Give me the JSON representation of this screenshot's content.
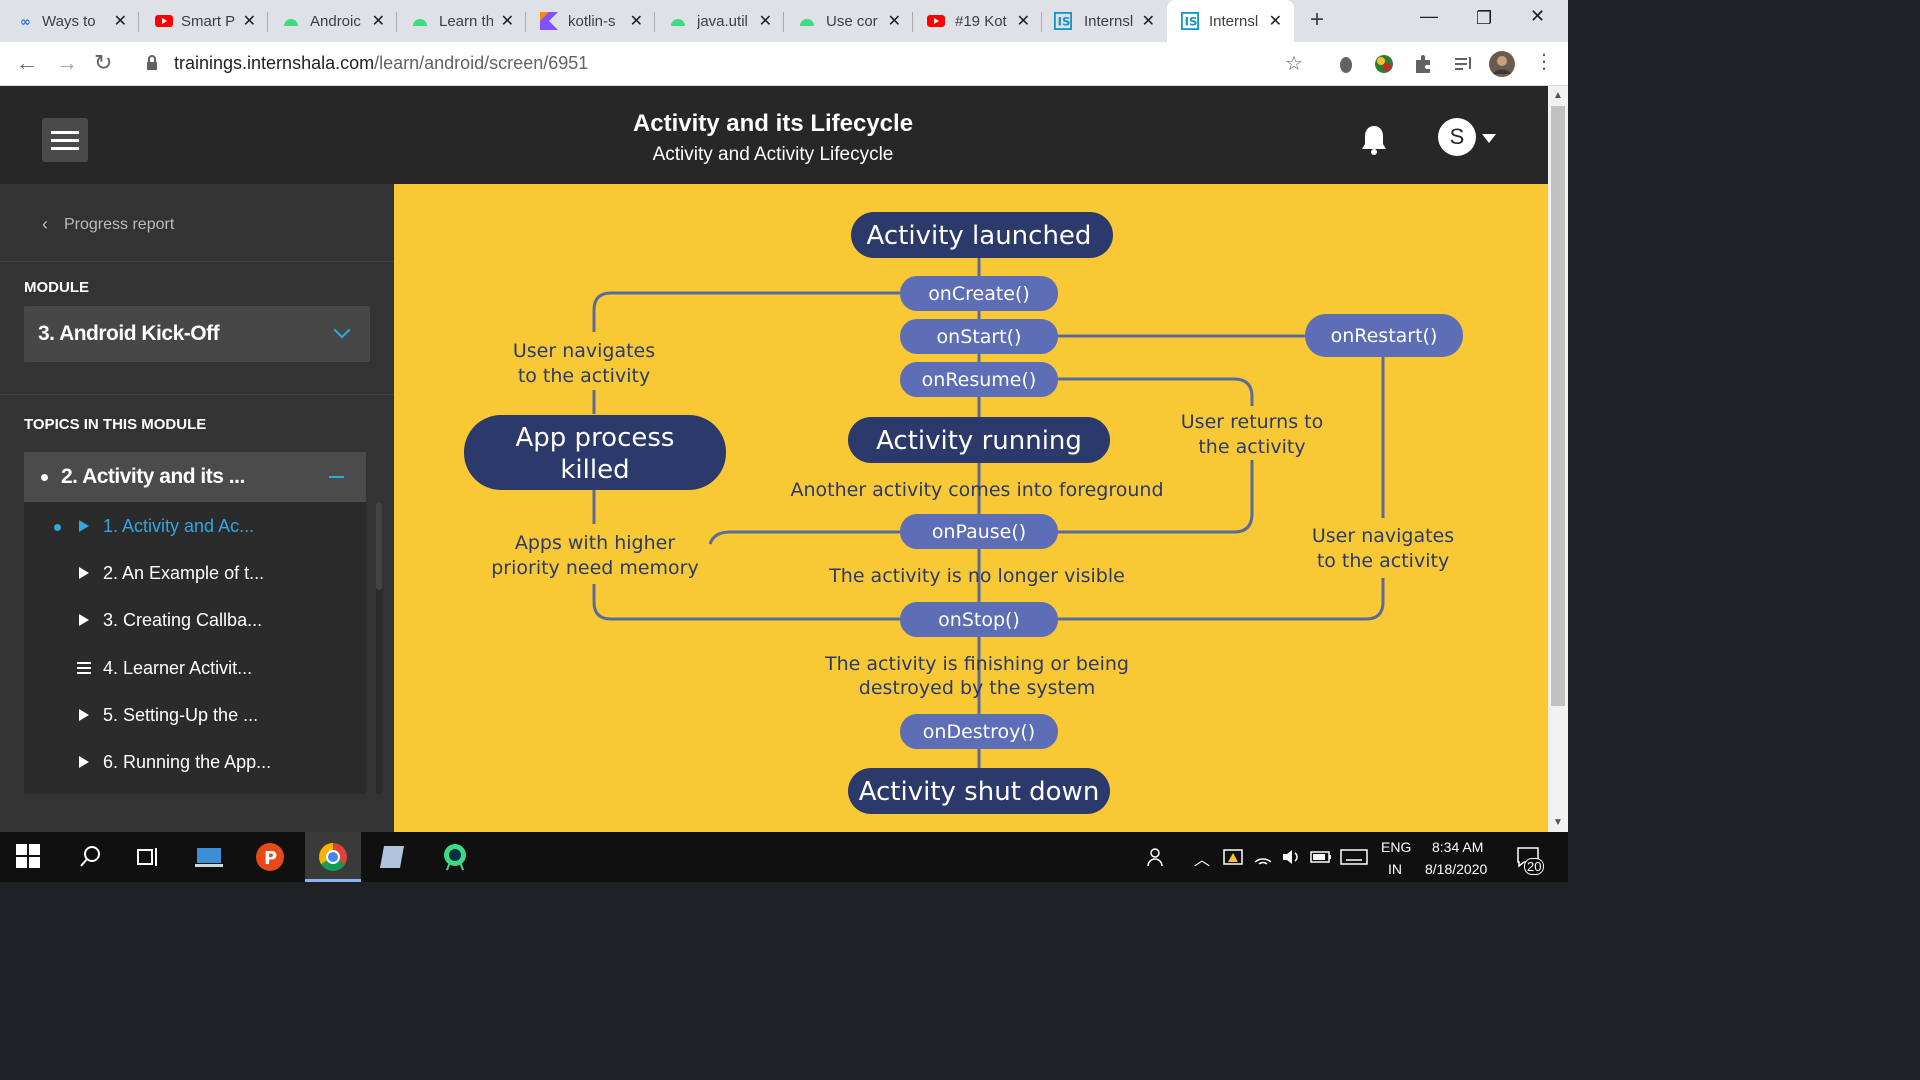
{
  "browser": {
    "tabs": [
      {
        "title": "Ways to",
        "icon": "coursera-icon"
      },
      {
        "title": "Smart P",
        "icon": "youtube-icon"
      },
      {
        "title": "Androic",
        "icon": "android-icon"
      },
      {
        "title": "Learn th",
        "icon": "android-icon"
      },
      {
        "title": "kotlin-s",
        "icon": "kotlin-icon"
      },
      {
        "title": "java.util",
        "icon": "android-icon"
      },
      {
        "title": "Use cor",
        "icon": "android-icon"
      },
      {
        "title": "#19 Kot",
        "icon": "youtube-icon"
      },
      {
        "title": "Internsl",
        "icon": "internshala-icon"
      },
      {
        "title": "Internsl",
        "icon": "internshala-icon",
        "active": true
      }
    ],
    "url_host": "trainings.internshala.com",
    "url_path": "/learn/android/screen/6951"
  },
  "header": {
    "title": "Activity and its Lifecycle",
    "subtitle": "Activity and Activity Lifecycle",
    "avatar_letter": "S"
  },
  "sidebar": {
    "progress_label": "Progress report",
    "module_label": "MODULE",
    "module_value": "3. Android Kick-Off",
    "topics_label": "TOPICS IN THIS MODULE",
    "current_topic": "2. Activity and its ...",
    "items": [
      {
        "label": "1. Activity and Ac...",
        "type": "video",
        "active": true
      },
      {
        "label": "2. An Example of t...",
        "type": "video"
      },
      {
        "label": "3. Creating Callba...",
        "type": "video"
      },
      {
        "label": "4. Learner Activit...",
        "type": "text"
      },
      {
        "label": "5. Setting-Up the ...",
        "type": "video"
      },
      {
        "label": "6. Running the App...",
        "type": "video"
      }
    ]
  },
  "diagram": {
    "colors": {
      "background": "#f9c935",
      "dark_pill": "#2b3a6b",
      "light_pill": "#5d6db6",
      "line": "#5a6a9a",
      "text": "#2b3a6b"
    },
    "activity_launched": "Activity launched",
    "on_create": "onCreate()",
    "on_start": "onStart()",
    "on_restart": "onRestart()",
    "on_resume": "onResume()",
    "activity_running": "Activity running",
    "on_pause": "onPause()",
    "on_stop": "onStop()",
    "on_destroy": "onDestroy()",
    "activity_shut_down": "Activity shut down",
    "app_process_killed_1": "App process",
    "app_process_killed_2": "killed",
    "user_navigates_left_1": "User navigates",
    "user_navigates_left_2": "to the activity",
    "user_returns_1": "User returns to",
    "user_returns_2": "the activity",
    "another_activity": "Another activity comes into foreground",
    "apps_higher_1": "Apps with higher",
    "apps_higher_2": "priority need memory",
    "user_navigates_right_1": "User navigates",
    "user_navigates_right_2": "to the activity",
    "no_longer_visible": "The activity is no longer visible",
    "finishing_1": "The activity is finishing or being",
    "finishing_2": "destroyed by the system"
  },
  "taskbar": {
    "language_1": "ENG",
    "language_2": "IN",
    "time": "8:34 AM",
    "date": "8/18/2020",
    "notifications": "20"
  }
}
